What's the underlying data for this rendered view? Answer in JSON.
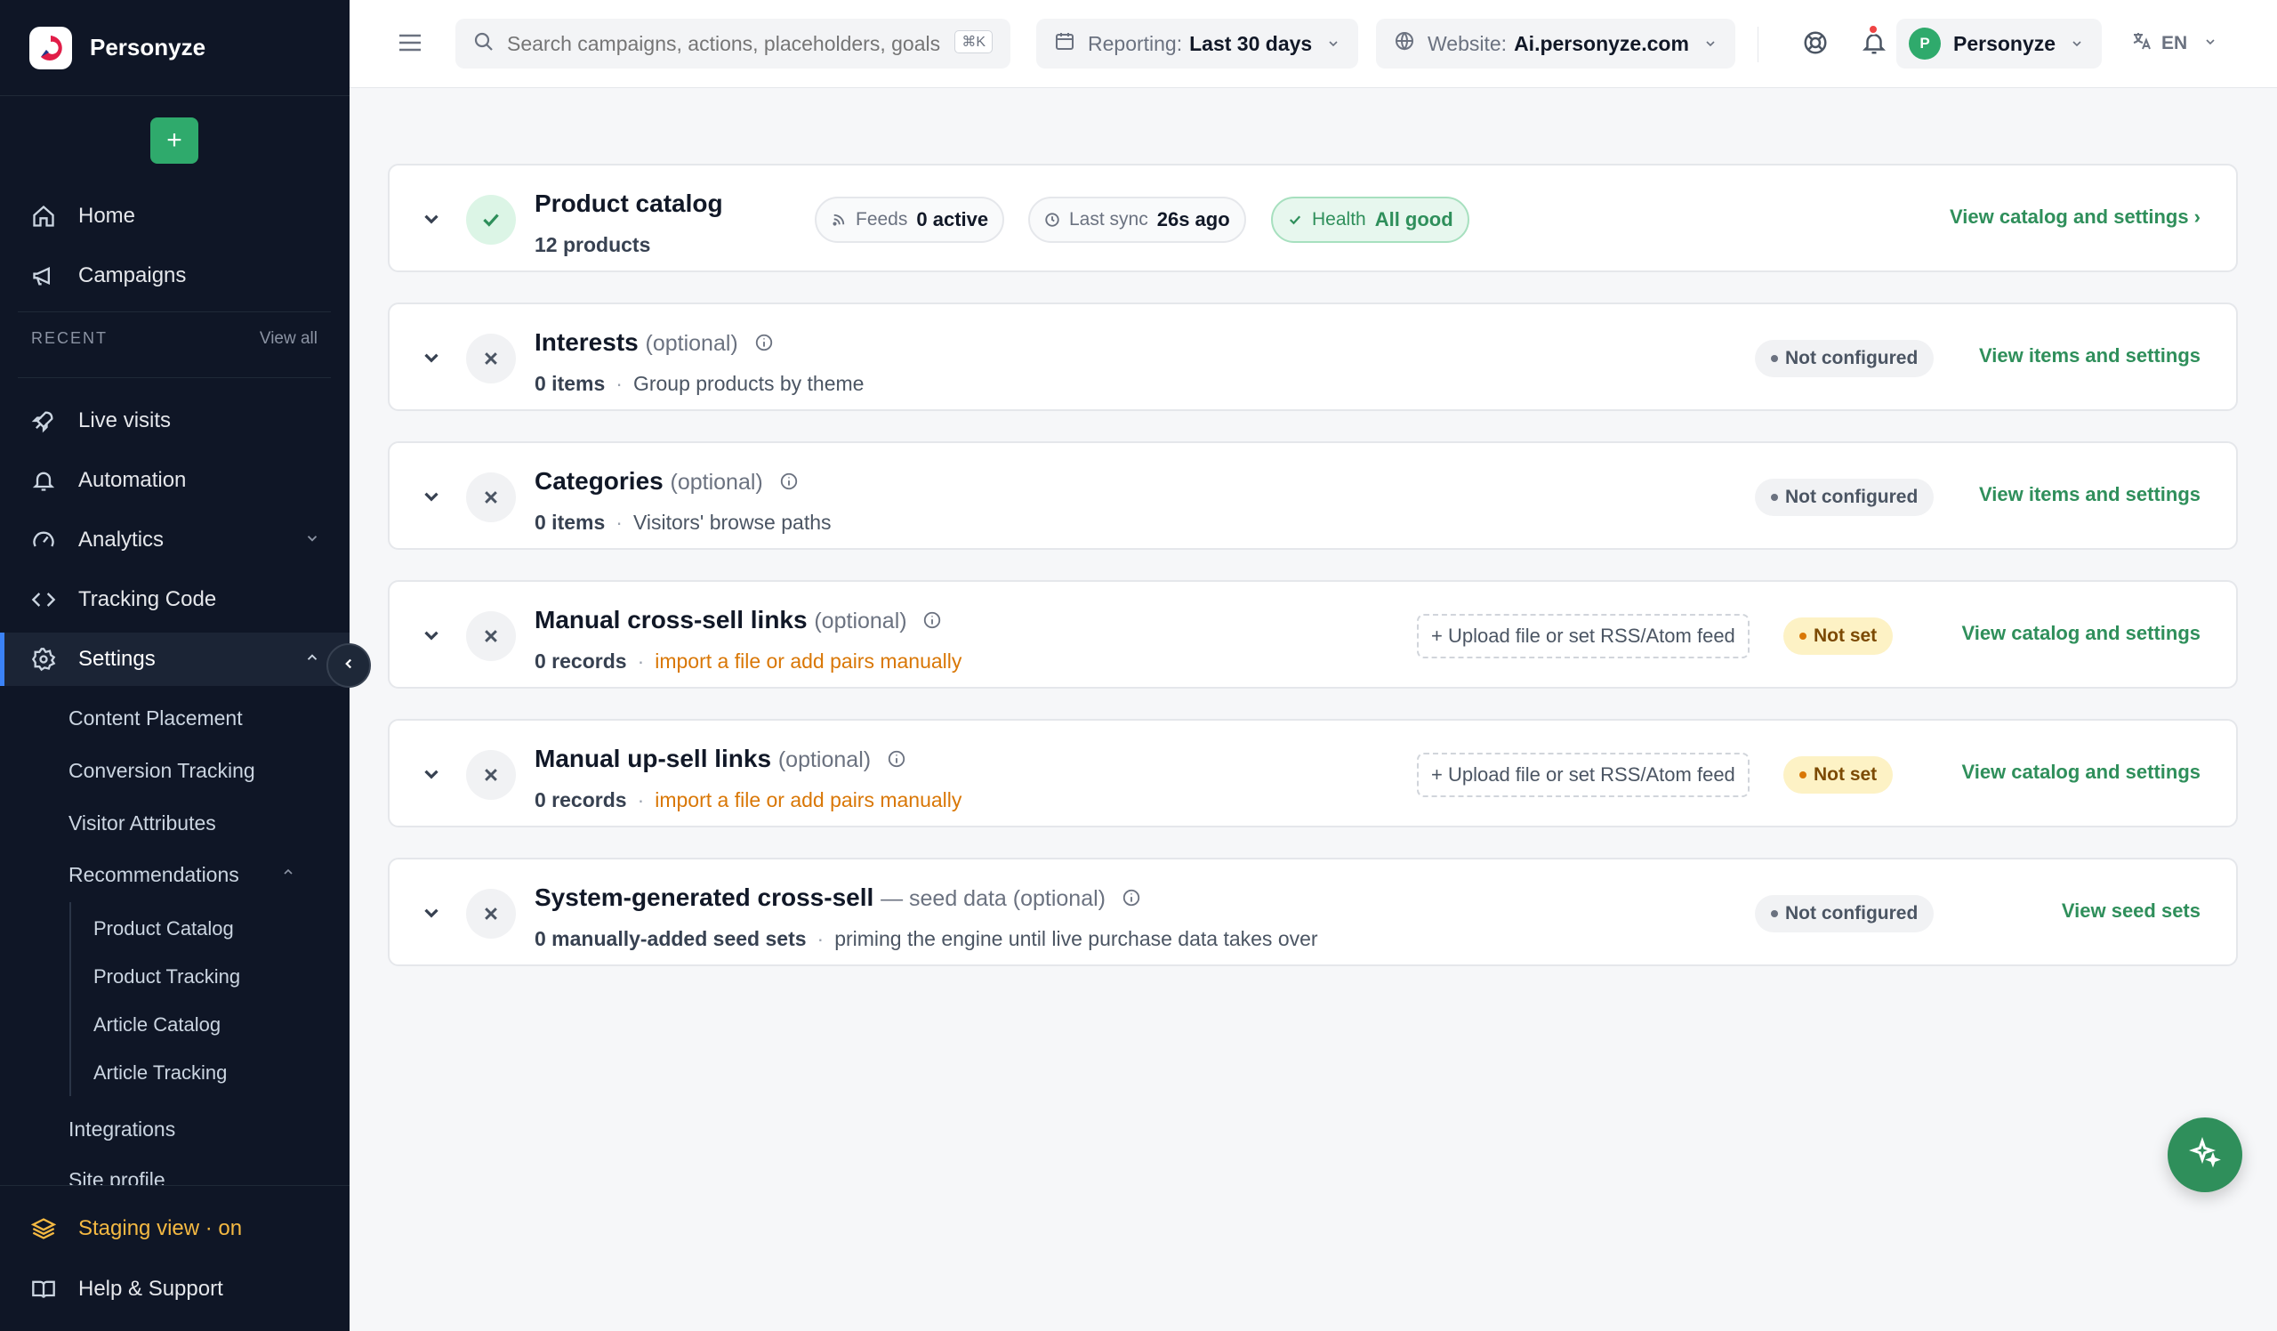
{
  "brand": {
    "name": "Personyze"
  },
  "sidebar": {
    "nav_top": [
      {
        "label": "Home",
        "icon": "home-icon"
      },
      {
        "label": "Campaigns",
        "icon": "megaphone-icon"
      }
    ],
    "recent_label": "RECENT",
    "view_all": "View all",
    "nav_main": [
      {
        "label": "Live visits",
        "icon": "rocket-icon"
      },
      {
        "label": "Automation",
        "icon": "bell-icon"
      },
      {
        "label": "Analytics",
        "icon": "gauge-icon"
      },
      {
        "label": "Tracking Code",
        "icon": "code-icon"
      },
      {
        "label": "Settings",
        "icon": "gear-icon"
      }
    ],
    "settings_sub": [
      "Content Placement",
      "Conversion Tracking",
      "Visitor Attributes",
      "Recommendations"
    ],
    "recommendations_sub": [
      "Product Catalog",
      "Product Tracking",
      "Article Catalog",
      "Article Tracking"
    ],
    "settings_sub_more": [
      "Integrations",
      "Site profile"
    ],
    "footer": {
      "staging": "Staging view · on",
      "help": "Help & Support"
    }
  },
  "header": {
    "search_placeholder": "Search campaigns, actions, placeholders, goals",
    "search_shortcut": "⌘K",
    "reporting_label": "Reporting:",
    "reporting_value": "Last 30 days",
    "website_label": "Website:",
    "website_value": "Ai.personyze.com",
    "user_initial": "P",
    "user_name": "Personyze",
    "language": "EN"
  },
  "cards": [
    {
      "title": "Product catalog",
      "subtitle_count": "12 products",
      "chips": {
        "feeds_label": "Feeds",
        "feeds_value": "0 active",
        "sync_label": "Last sync",
        "sync_value": "26s ago",
        "health_label": "Health",
        "health_value": "All good"
      },
      "link": "View catalog and settings ›"
    },
    {
      "title": "Interests",
      "optional": "(optional)",
      "count": "0 items",
      "desc": "Group products by theme",
      "badge": "Not configured",
      "link": "View items and settings"
    },
    {
      "title": "Categories",
      "optional": "(optional)",
      "count": "0 items",
      "desc": "Visitors' browse paths",
      "badge": "Not configured",
      "link": "View items and settings"
    },
    {
      "title": "Manual cross-sell links",
      "optional": "(optional)",
      "count": "0 records",
      "desc": "import a file or add pairs manually",
      "upload": "+ Upload file or set RSS/Atom feed",
      "badge": "Not set",
      "link": "View catalog and settings"
    },
    {
      "title": "Manual up-sell links",
      "optional": "(optional)",
      "count": "0 records",
      "desc": "import a file or add pairs manually",
      "upload": "+ Upload file or set RSS/Atom feed",
      "badge": "Not set",
      "link": "View catalog and settings"
    },
    {
      "title": "System-generated cross-sell",
      "optional": "— seed data (optional)",
      "count": "0 manually-added seed sets",
      "desc": "priming the engine until live purchase data takes over",
      "badge": "Not configured",
      "link": "View seed sets"
    }
  ],
  "colors": {
    "sidebar_bg": "#0f1626",
    "accent_green": "#2f8f5b",
    "warning": "#d97706",
    "staging": "#f5b942"
  }
}
